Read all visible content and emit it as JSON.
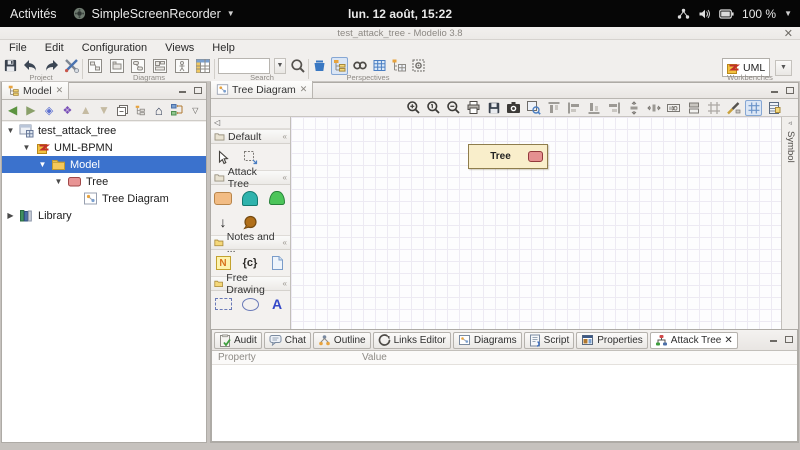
{
  "top_bar": {
    "activities_label": "Activités",
    "app_name": "SimpleScreenRecorder",
    "clock": "lun. 12 août, 15:22",
    "battery_percent": "100 %"
  },
  "window": {
    "title": "test_attack_tree - Modelio 3.8"
  },
  "menu": {
    "items": [
      {
        "label": "File"
      },
      {
        "label": "Edit"
      },
      {
        "label": "Configuration"
      },
      {
        "label": "Views"
      },
      {
        "label": "Help"
      }
    ]
  },
  "toolbar": {
    "project_label": "Project",
    "diagrams_label": "Diagrams",
    "search_label": "Search",
    "search_value": "",
    "perspectives_label": "Perspectives",
    "workbenches_label": "Workbenches",
    "workbench_selected": "UML"
  },
  "model_panel": {
    "tab_label": "Model",
    "tree": [
      {
        "label": "test_attack_tree",
        "level": 0,
        "expanded": true,
        "icon": "project"
      },
      {
        "label": "UML-BPMN",
        "level": 1,
        "expanded": true,
        "icon": "module"
      },
      {
        "label": "Model",
        "level": 2,
        "expanded": true,
        "icon": "folder",
        "selected": true
      },
      {
        "label": "Tree",
        "level": 3,
        "expanded": true,
        "icon": "attack-tree-node"
      },
      {
        "label": "Tree Diagram",
        "level": 4,
        "expanded": null,
        "icon": "diagram"
      },
      {
        "label": "Library",
        "level": 0,
        "expanded": false,
        "icon": "library"
      }
    ]
  },
  "editor": {
    "tab_label": "Tree Diagram",
    "symbol_tab_label": "Symbol",
    "palette": {
      "sections": [
        {
          "title": "Default"
        },
        {
          "title": "Attack Tree"
        },
        {
          "title": "Notes and ..."
        },
        {
          "title": "Free Drawing"
        }
      ],
      "note_letter": "N",
      "constraint_label": "{c}",
      "text_tool_label": "A"
    },
    "canvas": {
      "node_label": "Tree"
    }
  },
  "bottom_panel": {
    "tabs": [
      {
        "label": "Audit"
      },
      {
        "label": "Chat"
      },
      {
        "label": "Outline"
      },
      {
        "label": "Links Editor"
      },
      {
        "label": "Diagrams"
      },
      {
        "label": "Script"
      },
      {
        "label": "Properties"
      },
      {
        "label": "Attack Tree",
        "active": true
      }
    ],
    "columns": {
      "property": "Property",
      "value": "Value"
    }
  },
  "colors": {
    "selection_blue": "#3b72cd",
    "node_fill": "#f9eecb",
    "node_border": "#8f7d4c",
    "node_icon_pink": "#e59090",
    "palette_orange": "#f0b074",
    "palette_teal": "#2fb3ad",
    "palette_green": "#4cc55a",
    "palette_brown": "#b06f1a"
  }
}
